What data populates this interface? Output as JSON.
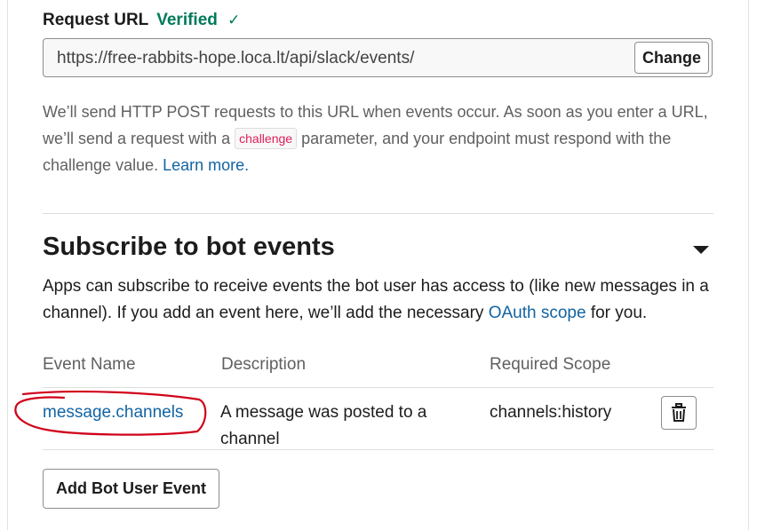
{
  "request_url": {
    "label": "Request URL",
    "status": "Verified",
    "status_icon": "checkmark-icon",
    "value": "https://free-rabbits-hope.loca.lt/api/slack/events/",
    "change_label": "Change"
  },
  "help": {
    "part1": "We’ll send HTTP POST requests to this URL when events occur. As soon as you enter a URL, we’ll send a request with a ",
    "code": "challenge",
    "part2": " parameter, and your endpoint must respond with the challenge value. ",
    "learn_more": "Learn more."
  },
  "bot_events": {
    "title": "Subscribe to bot events",
    "desc_part1": "Apps can subscribe to receive events the bot user has access to (like new messages in a channel). If you add an event here, we’ll add the necessary ",
    "desc_link": "OAuth scope",
    "desc_part2": " for you.",
    "columns": [
      "Event Name",
      "Description",
      "Required Scope"
    ],
    "rows": [
      {
        "name": "message.channels",
        "description": "A message was posted to a channel",
        "scope": "channels:history"
      }
    ],
    "add_button": "Add Bot User Event"
  },
  "colors": {
    "verified": "#007a5a",
    "link": "#1264a3",
    "code": "#e01e5a",
    "annotation": "#d0021b"
  }
}
